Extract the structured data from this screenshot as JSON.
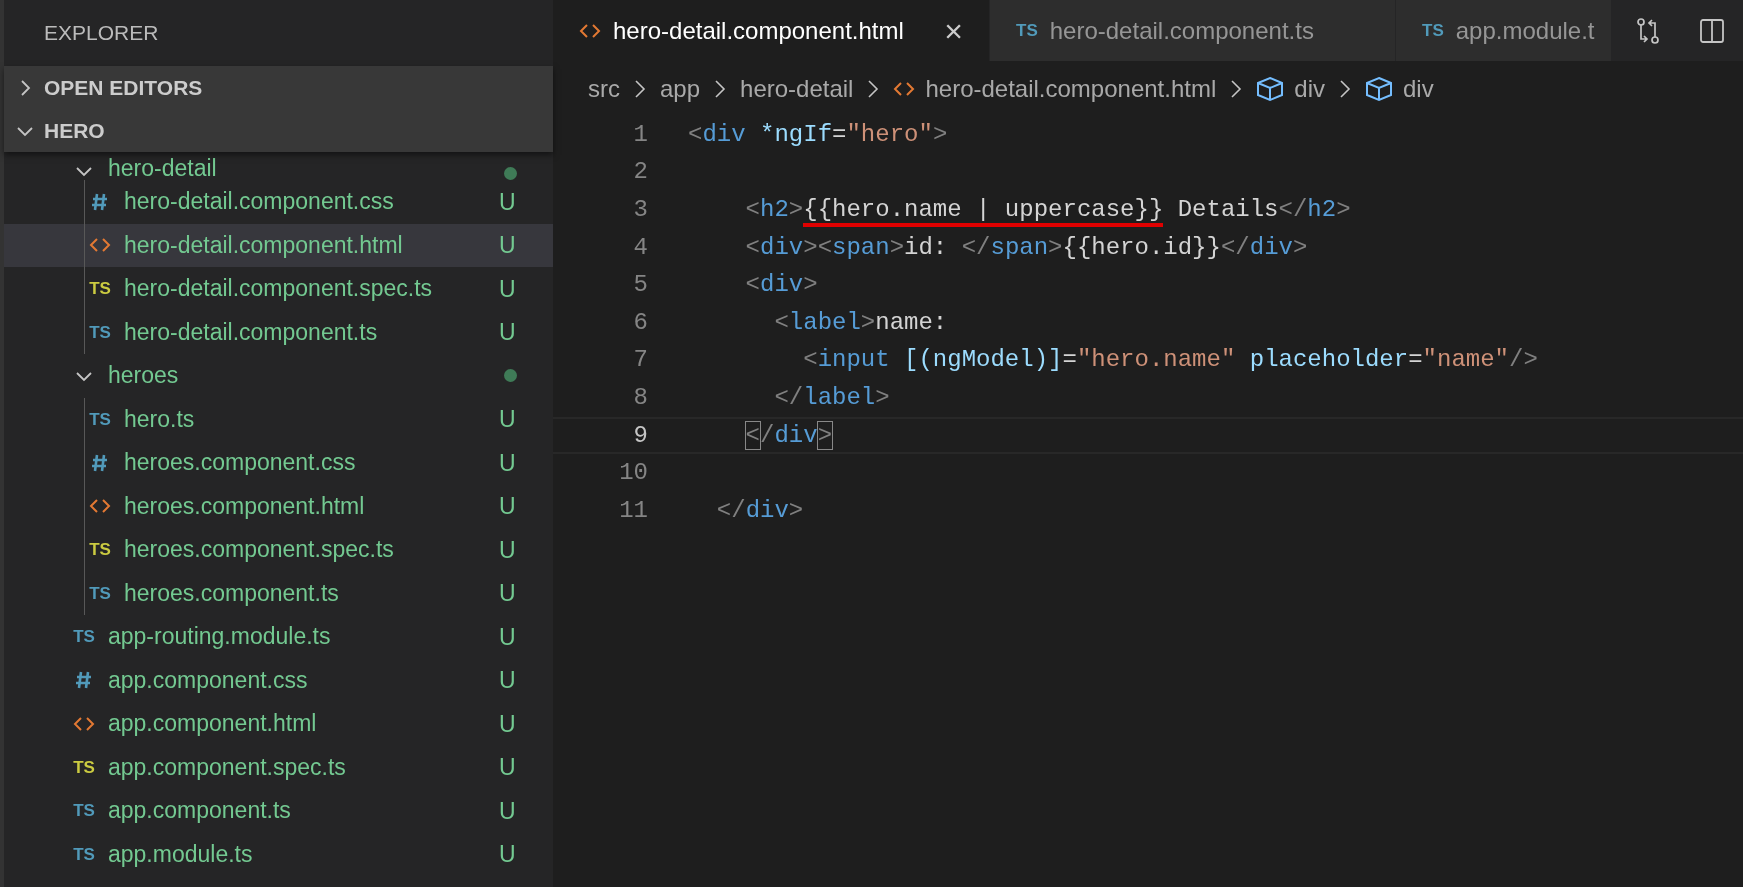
{
  "sidebar": {
    "title": "EXPLORER",
    "sections": [
      {
        "label": "OPEN EDITORS",
        "expanded": false
      },
      {
        "label": "HERO",
        "expanded": true
      }
    ],
    "tree": [
      {
        "kind": "folder",
        "name": "hero-detail",
        "expanded": true,
        "has_changes": true,
        "children": [
          {
            "kind": "css",
            "name": "hero-detail.component.css",
            "status": "U",
            "selected": false
          },
          {
            "kind": "html",
            "name": "hero-detail.component.html",
            "status": "U",
            "selected": true
          },
          {
            "kind": "spec",
            "icon_text": "TS",
            "name": "hero-detail.component.spec.ts",
            "status": "U",
            "selected": false
          },
          {
            "kind": "ts",
            "icon_text": "TS",
            "name": "hero-detail.component.ts",
            "status": "U",
            "selected": false
          }
        ]
      },
      {
        "kind": "folder",
        "name": "heroes",
        "expanded": true,
        "has_changes": true,
        "children": [
          {
            "kind": "ts",
            "icon_text": "TS",
            "name": "hero.ts",
            "status": "U",
            "selected": false
          },
          {
            "kind": "css",
            "name": "heroes.component.css",
            "status": "U",
            "selected": false
          },
          {
            "kind": "html",
            "name": "heroes.component.html",
            "status": "U",
            "selected": false
          },
          {
            "kind": "spec",
            "icon_text": "TS",
            "name": "heroes.component.spec.ts",
            "status": "U",
            "selected": false
          },
          {
            "kind": "ts",
            "icon_text": "TS",
            "name": "heroes.component.ts",
            "status": "U",
            "selected": false
          }
        ]
      },
      {
        "kind": "ts",
        "icon_text": "TS",
        "name": "app-routing.module.ts",
        "status": "U",
        "selected": false
      },
      {
        "kind": "css",
        "name": "app.component.css",
        "status": "U",
        "selected": false
      },
      {
        "kind": "html",
        "name": "app.component.html",
        "status": "U",
        "selected": false
      },
      {
        "kind": "spec",
        "icon_text": "TS",
        "name": "app.component.spec.ts",
        "status": "U",
        "selected": false
      },
      {
        "kind": "ts",
        "icon_text": "TS",
        "name": "app.component.ts",
        "status": "U",
        "selected": false
      },
      {
        "kind": "ts",
        "icon_text": "TS",
        "name": "app.module.ts",
        "status": "U",
        "selected": false
      }
    ]
  },
  "tabs": [
    {
      "kind": "html",
      "label": "hero-detail.component.html",
      "selected": true,
      "close": "×"
    },
    {
      "kind": "ts",
      "icon_text": "TS",
      "label": "hero-detail.component.ts",
      "selected": false
    },
    {
      "kind": "ts",
      "icon_text": "TS",
      "label": "app.module.t",
      "selected": false
    }
  ],
  "breadcrumbs": [
    {
      "kind": "text",
      "label": "src"
    },
    {
      "kind": "text",
      "label": "app"
    },
    {
      "kind": "text",
      "label": "hero-detail"
    },
    {
      "kind": "html",
      "label": "hero-detail.component.html"
    },
    {
      "kind": "element",
      "label": "div"
    },
    {
      "kind": "element",
      "label": "div"
    }
  ],
  "code": [
    {
      "number": "1",
      "current": false,
      "tokens": [
        {
          "kind": "punct",
          "text": "<"
        },
        {
          "kind": "tag",
          "text": "div"
        },
        {
          "kind": "attr",
          "text": " *ngIf"
        },
        {
          "kind": "text",
          "text": "="
        },
        {
          "kind": "string",
          "text": "\"hero\""
        },
        {
          "kind": "punct",
          "text": ">"
        }
      ]
    },
    {
      "number": "2",
      "current": false
    },
    {
      "number": "3",
      "current": false,
      "tokens": [
        {
          "kind": "punct",
          "text": "    <"
        },
        {
          "kind": "tag",
          "text": "h2"
        },
        {
          "kind": "punct",
          "text": ">"
        },
        {
          "kind": "text",
          "text": "{{hero.name | uppercase}}",
          "underlined": true
        },
        {
          "kind": "text",
          "text": " Details"
        },
        {
          "kind": "punct",
          "text": "</"
        },
        {
          "kind": "tag",
          "text": "h2"
        },
        {
          "kind": "punct",
          "text": ">"
        }
      ]
    },
    {
      "number": "4",
      "current": false,
      "tokens": [
        {
          "kind": "punct",
          "text": "    <"
        },
        {
          "kind": "tag",
          "text": "div"
        },
        {
          "kind": "punct",
          "text": "><"
        },
        {
          "kind": "tag",
          "text": "span"
        },
        {
          "kind": "punct",
          "text": ">"
        },
        {
          "kind": "text",
          "text": "id: "
        },
        {
          "kind": "punct",
          "text": "</"
        },
        {
          "kind": "tag",
          "text": "span"
        },
        {
          "kind": "punct",
          "text": ">"
        },
        {
          "kind": "text",
          "text": "{{hero.id}}"
        },
        {
          "kind": "punct",
          "text": "</"
        },
        {
          "kind": "tag",
          "text": "div"
        },
        {
          "kind": "punct",
          "text": ">"
        }
      ]
    },
    {
      "number": "5",
      "current": false,
      "tokens": [
        {
          "kind": "punct",
          "text": "    <"
        },
        {
          "kind": "tag",
          "text": "div"
        },
        {
          "kind": "punct",
          "text": ">"
        }
      ]
    },
    {
      "number": "6",
      "current": false,
      "tokens": [
        {
          "kind": "punct",
          "text": "      <"
        },
        {
          "kind": "tag",
          "text": "label"
        },
        {
          "kind": "punct",
          "text": ">"
        },
        {
          "kind": "text",
          "text": "name:"
        }
      ]
    },
    {
      "number": "7",
      "current": false,
      "tokens": [
        {
          "kind": "punct",
          "text": "        <"
        },
        {
          "kind": "tag",
          "text": "input"
        },
        {
          "kind": "attr",
          "text": " [(ngModel)]"
        },
        {
          "kind": "text",
          "text": "="
        },
        {
          "kind": "string",
          "text": "\"hero.name\""
        },
        {
          "kind": "attr",
          "text": " placeholder"
        },
        {
          "kind": "text",
          "text": "="
        },
        {
          "kind": "string",
          "text": "\"name\""
        },
        {
          "kind": "punct",
          "text": "/>"
        }
      ]
    },
    {
      "number": "8",
      "current": false,
      "tokens": [
        {
          "kind": "punct",
          "text": "      </"
        },
        {
          "kind": "tag",
          "text": "label"
        },
        {
          "kind": "punct",
          "text": ">"
        }
      ]
    },
    {
      "number": "9",
      "current": true,
      "tokens": [
        {
          "kind": "punct",
          "text": "    <",
          "boxed": true
        },
        {
          "kind": "punct",
          "text": "/"
        },
        {
          "kind": "tag",
          "text": "div"
        },
        {
          "kind": "punct",
          "text": ">",
          "boxed": true
        }
      ]
    },
    {
      "number": "10",
      "current": false
    },
    {
      "number": "11",
      "current": false,
      "tokens": [
        {
          "kind": "punct",
          "text": "  </"
        },
        {
          "kind": "tag",
          "text": "div"
        },
        {
          "kind": "punct",
          "text": ">"
        }
      ]
    }
  ]
}
